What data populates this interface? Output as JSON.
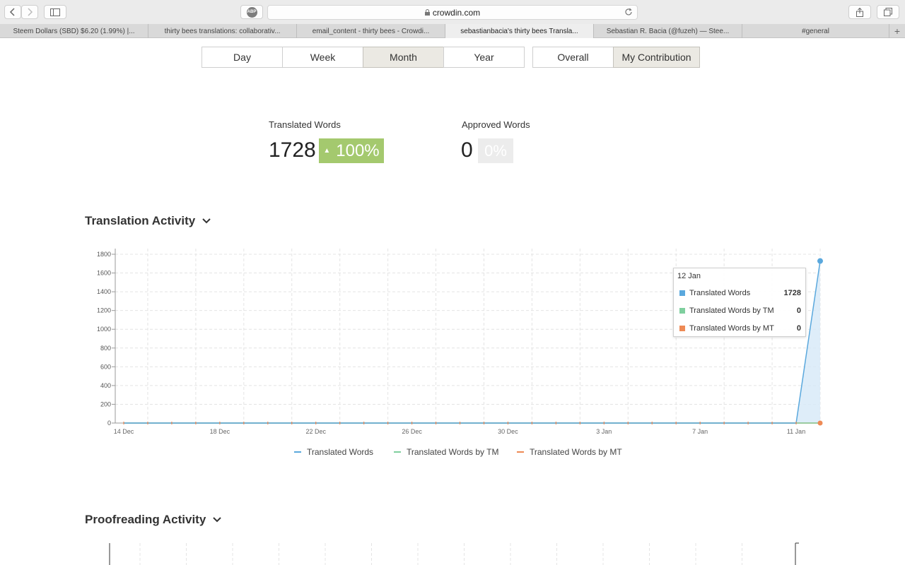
{
  "browser": {
    "url": "crowdin.com",
    "tabs": [
      {
        "label": "Steem Dollars (SBD) $6.20 (1.99%) |...",
        "active": false
      },
      {
        "label": "thirty bees translations: collaborativ...",
        "active": false
      },
      {
        "label": "email_content - thirty bees - Crowdi...",
        "active": false
      },
      {
        "label": "sebastianbacia's thirty bees Transla...",
        "active": true
      },
      {
        "label": "Sebastian R. Bacia (@fuzeh) — Stee...",
        "active": false
      },
      {
        "label": "#general",
        "active": false
      }
    ],
    "abp_label": "ABP",
    "new_tab_symbol": "+"
  },
  "period": {
    "buttons": [
      {
        "label": "Day",
        "active": false
      },
      {
        "label": "Week",
        "active": false
      },
      {
        "label": "Month",
        "active": true
      },
      {
        "label": "Year",
        "active": false
      }
    ],
    "scope_buttons": [
      {
        "label": "Overall",
        "active": false
      },
      {
        "label": "My Contribution",
        "active": true
      }
    ]
  },
  "stats": {
    "translated": {
      "label": "Translated Words",
      "value": "1728",
      "change": "100%"
    },
    "approved": {
      "label": "Approved Words",
      "value": "0",
      "change": "0%"
    }
  },
  "translation_section": {
    "title": "Translation Activity"
  },
  "proofreading_section": {
    "title": "Proofreading Activity"
  },
  "colors": {
    "translated": "#5aa8dd",
    "tm": "#7fcf9e",
    "mt": "#ee8a55",
    "accent_green": "#a4c96e"
  },
  "tooltip": {
    "date": "12 Jan",
    "rows": [
      {
        "label": "Translated Words",
        "value": "1728",
        "color": "#5aa8dd"
      },
      {
        "label": "Translated Words by TM",
        "value": "0",
        "color": "#7fcf9e"
      },
      {
        "label": "Translated Words by MT",
        "value": "0",
        "color": "#ee8a55"
      }
    ]
  },
  "chart_data": {
    "type": "line",
    "title": "Translation Activity",
    "xlabel": "",
    "ylabel": "",
    "ylim": [
      0,
      1800
    ],
    "yticks": [
      0,
      200,
      400,
      600,
      800,
      1000,
      1200,
      1400,
      1600,
      1800
    ],
    "x_tick_labels": [
      "14 Dec",
      "18 Dec",
      "22 Dec",
      "26 Dec",
      "30 Dec",
      "3 Jan",
      "7 Jan",
      "11 Jan"
    ],
    "x": [
      "14 Dec",
      "15 Dec",
      "16 Dec",
      "17 Dec",
      "18 Dec",
      "19 Dec",
      "20 Dec",
      "21 Dec",
      "22 Dec",
      "23 Dec",
      "24 Dec",
      "25 Dec",
      "26 Dec",
      "27 Dec",
      "28 Dec",
      "29 Dec",
      "30 Dec",
      "31 Dec",
      "1 Jan",
      "2 Jan",
      "3 Jan",
      "4 Jan",
      "5 Jan",
      "6 Jan",
      "7 Jan",
      "8 Jan",
      "9 Jan",
      "10 Jan",
      "11 Jan",
      "12 Jan"
    ],
    "series": [
      {
        "name": "Translated Words",
        "values": [
          0,
          0,
          0,
          0,
          0,
          0,
          0,
          0,
          0,
          0,
          0,
          0,
          0,
          0,
          0,
          0,
          0,
          0,
          0,
          0,
          0,
          0,
          0,
          0,
          0,
          0,
          0,
          0,
          0,
          1728
        ]
      },
      {
        "name": "Translated Words by TM",
        "values": [
          0,
          0,
          0,
          0,
          0,
          0,
          0,
          0,
          0,
          0,
          0,
          0,
          0,
          0,
          0,
          0,
          0,
          0,
          0,
          0,
          0,
          0,
          0,
          0,
          0,
          0,
          0,
          0,
          0,
          0
        ]
      },
      {
        "name": "Translated Words by MT",
        "values": [
          0,
          0,
          0,
          0,
          0,
          0,
          0,
          0,
          0,
          0,
          0,
          0,
          0,
          0,
          0,
          0,
          0,
          0,
          0,
          0,
          0,
          0,
          0,
          0,
          0,
          0,
          0,
          0,
          0,
          0
        ]
      }
    ],
    "grid": true,
    "legend": "bottom"
  }
}
